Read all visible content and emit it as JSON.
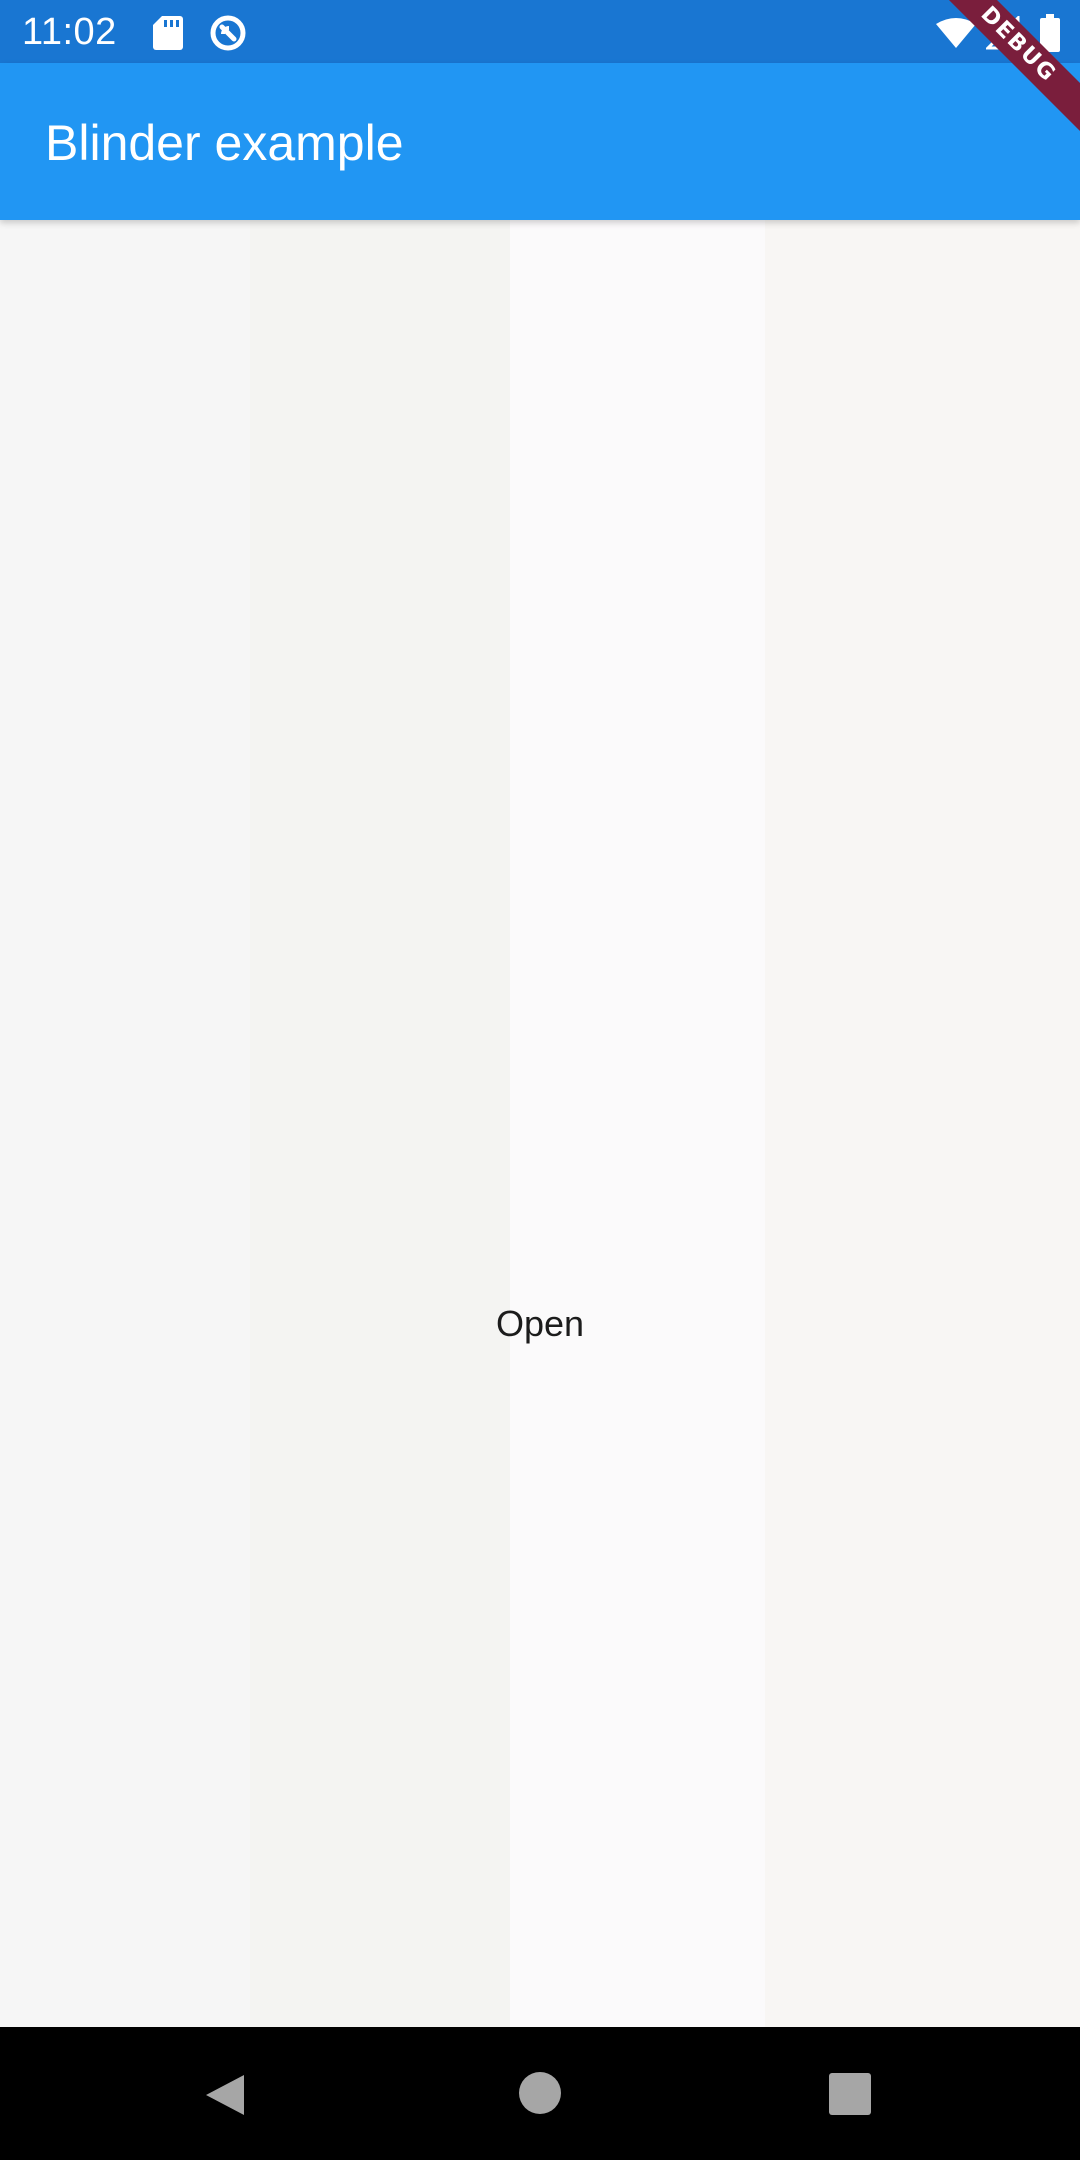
{
  "status_bar": {
    "time": "11:02",
    "icons": [
      "sd-card-icon",
      "sync-icon",
      "wifi-icon",
      "signal-icon",
      "battery-icon"
    ]
  },
  "app_bar": {
    "title": "Blinder example",
    "color": "#2196f3"
  },
  "debug_banner": {
    "label": "DEBUG",
    "color": "#7a1e3c"
  },
  "main": {
    "open_button_label": "Open"
  },
  "nav_bar": {
    "icons": [
      "back-icon",
      "home-icon",
      "recents-icon"
    ]
  }
}
